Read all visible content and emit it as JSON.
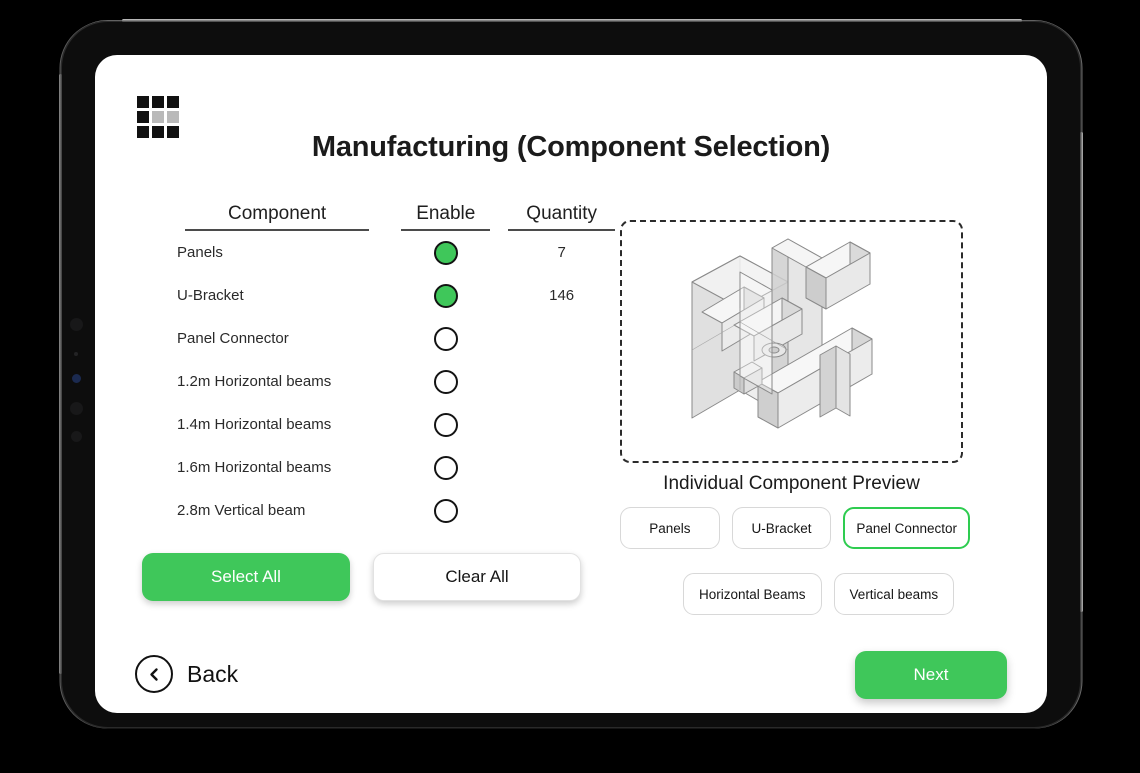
{
  "app": {
    "title": "Manufacturing (Component Selection)",
    "grid_icon": "app-grid-icon",
    "grid_cells": [
      "dark",
      "dark",
      "dark",
      "dark",
      "light",
      "light",
      "dark",
      "dark",
      "dark"
    ]
  },
  "table": {
    "headers": {
      "component": "Component",
      "enable": "Enable",
      "quantity": "Quantity"
    },
    "rows": [
      {
        "name": "Panels",
        "enabled": true,
        "quantity": "7"
      },
      {
        "name": "U-Bracket",
        "enabled": true,
        "quantity": "146"
      },
      {
        "name": "Panel Connector",
        "enabled": false,
        "quantity": ""
      },
      {
        "name": "1.2m Horizontal beams",
        "enabled": false,
        "quantity": ""
      },
      {
        "name": "1.4m Horizontal beams",
        "enabled": false,
        "quantity": ""
      },
      {
        "name": "1.6m Horizontal beams",
        "enabled": false,
        "quantity": ""
      },
      {
        "name": "2.8m Vertical beam",
        "enabled": false,
        "quantity": ""
      }
    ]
  },
  "bulk_actions": {
    "select_all_label": "Select All",
    "clear_all_label": "Clear All"
  },
  "preview": {
    "heading": "Individual Component Preview",
    "chips_row_1": [
      {
        "label": "Panels",
        "selected": false
      },
      {
        "label": "U-Bracket",
        "selected": false
      },
      {
        "label": "Panel Connector",
        "selected": true
      }
    ],
    "chips_row_2": [
      {
        "label": "Horizontal Beams",
        "selected": false
      },
      {
        "label": "Vertical beams",
        "selected": false
      }
    ],
    "model_description": "isometric-panel-connector-bracket"
  },
  "navigation": {
    "back_label": "Back",
    "back_icon": "chevron-left-circle-icon",
    "next_label": "Next"
  },
  "colors": {
    "accent_green": "#3fc75a",
    "selected_chip_border": "#2ecc50",
    "text_primary": "#1b1b1b",
    "device_body": "#0d0d0d",
    "page_background": "#000000"
  }
}
